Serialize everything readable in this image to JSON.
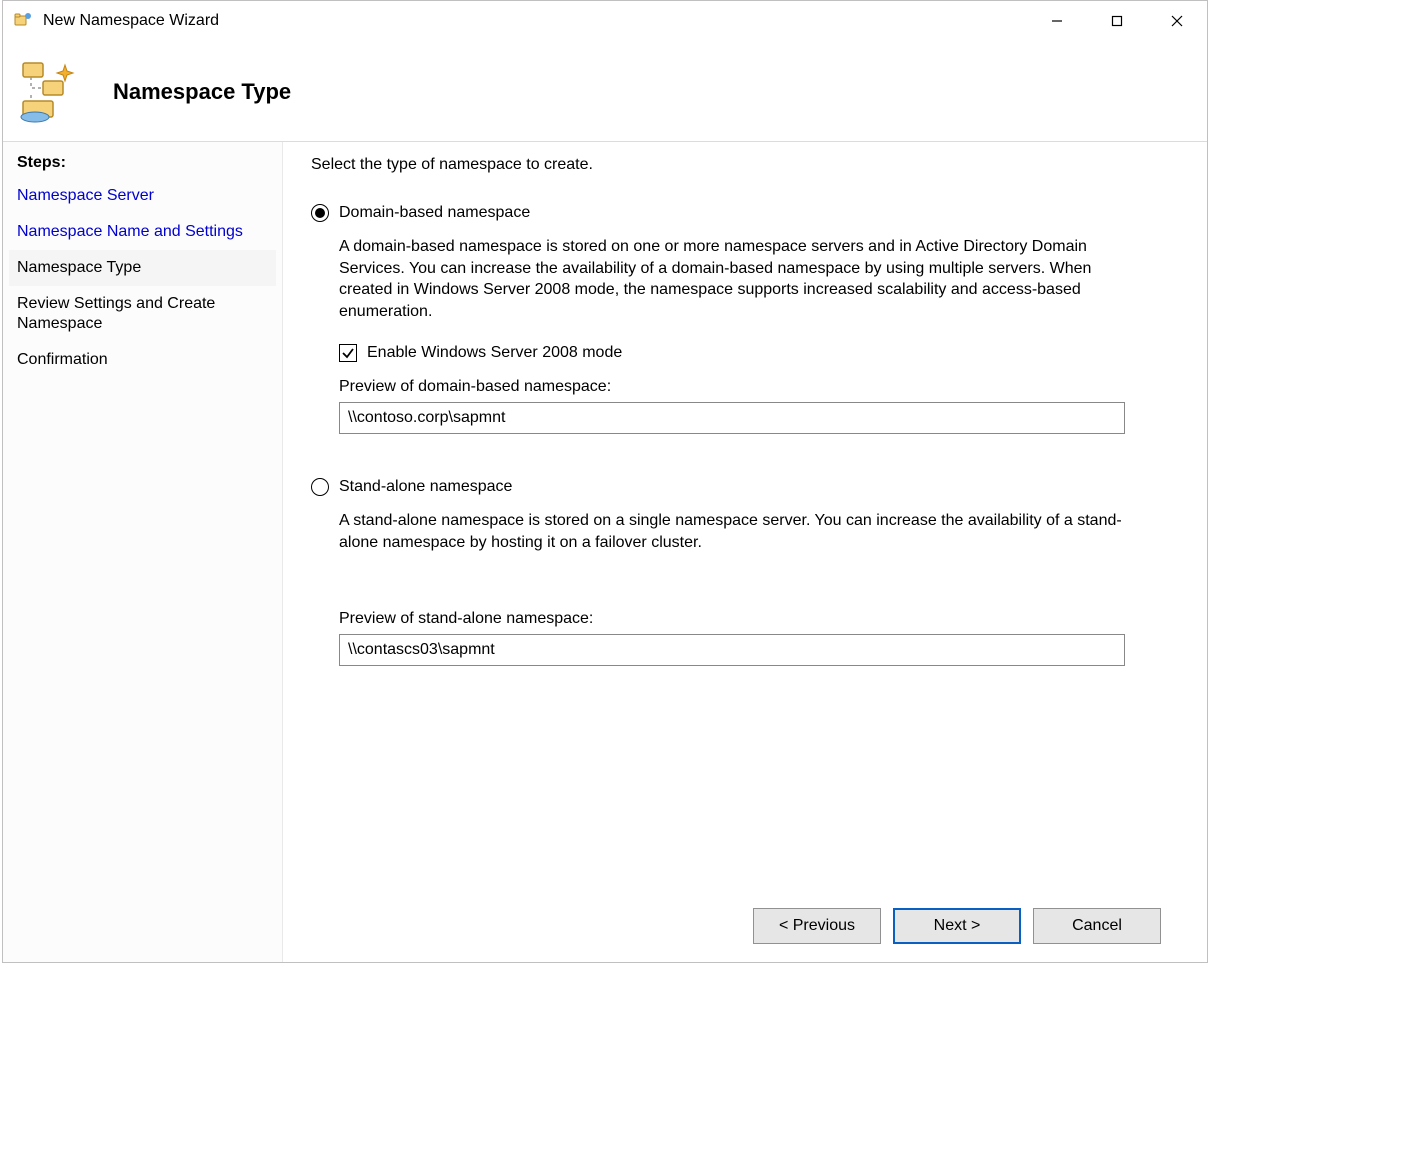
{
  "window": {
    "title": "New Namespace Wizard"
  },
  "header": {
    "page_title": "Namespace Type"
  },
  "sidebar": {
    "steps_label": "Steps:",
    "items": [
      {
        "label": "Namespace Server",
        "state": "link"
      },
      {
        "label": "Namespace Name and Settings",
        "state": "link"
      },
      {
        "label": "Namespace Type",
        "state": "current"
      },
      {
        "label": "Review Settings and Create Namespace",
        "state": "disabled"
      },
      {
        "label": "Confirmation",
        "state": "disabled"
      }
    ]
  },
  "main": {
    "instruction": "Select the type of namespace to create.",
    "option_domain": {
      "label": "Domain-based namespace",
      "selected": true,
      "description": "A domain-based namespace is stored on one or more namespace servers and in Active Directory Domain Services. You can increase the availability of a domain-based namespace by using multiple servers. When created in Windows Server 2008 mode, the namespace supports increased scalability and access-based enumeration.",
      "checkbox": {
        "label": "Enable Windows Server 2008 mode",
        "checked": true
      },
      "preview_label": "Preview of domain-based namespace:",
      "preview_value": "\\\\contoso.corp\\sapmnt"
    },
    "option_standalone": {
      "label": "Stand-alone namespace",
      "selected": false,
      "description": "A stand-alone namespace is stored on a single namespace server. You can increase the availability of a stand-alone namespace by hosting it on a failover cluster.",
      "preview_label": "Preview of stand-alone namespace:",
      "preview_value": "\\\\contascs03\\sapmnt"
    }
  },
  "footer": {
    "previous": "< Previous",
    "next": "Next >",
    "cancel": "Cancel"
  }
}
